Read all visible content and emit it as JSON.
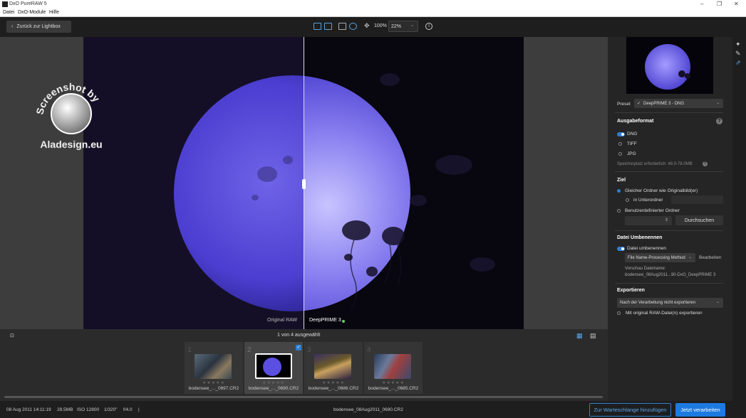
{
  "window": {
    "title": "DxO PureRAW 5",
    "controls": [
      "–",
      "❐",
      "✕"
    ]
  },
  "menu": [
    "Datei",
    "DxO-Module",
    "Hilfe"
  ],
  "toolbar": {
    "back_label": "Zurück zur Lightbox",
    "zoom_100": "100%",
    "zoom_value": "22%",
    "info_icon": "i"
  },
  "viewer": {
    "label_original": "Original RAW",
    "label_processed": "DeepPRIME 3",
    "watermark": "Screenshot by Aladesign.eu"
  },
  "panel": {
    "preset_label": "Preset",
    "preset_value": "DeepPRIME 3 - DNG",
    "output_heading": "Ausgabeformat",
    "format_dng": "DNG",
    "format_tiff": "TIFF",
    "format_jpg": "JPG",
    "storage_text": "Speicherplatz erforderlich: 48.0-78.0MB",
    "ziel_heading": "Ziel",
    "same_folder": "Gleicher Ordner wie Originalbild(er)",
    "subfolder": "in Unterordner",
    "custom_folder": "Benutzerdefinierter Ordner",
    "browse": "Durchsuchen",
    "rename_heading": "Datei Umbenennen",
    "rename_toggle": "Datei umbenennen",
    "rename_method": "File Name-Processing Method",
    "edit": "Bearbeiten",
    "preview_label": "Vorschau Dateiname:",
    "preview_value": "bodensee_08Aug2011...90-DxO_DeepPRIME 3",
    "export_heading": "Exportieren",
    "export_value": "Nach der Verarbeitung nicht exportieren",
    "export_raw": "Mit original RAW-Datei(n) exportieren"
  },
  "filmstrip": {
    "selection_text": "1 von 4 ausgewählt",
    "items": [
      {
        "num": "1",
        "name": "bodensee_..._0697.CR2"
      },
      {
        "num": "2",
        "name": "bodensee_..._0690.CR2"
      },
      {
        "num": "3",
        "name": "bodensee_..._0686.CR2"
      },
      {
        "num": "4",
        "name": "bodensee_..._0685.CR2"
      }
    ],
    "stars": "★★★★★"
  },
  "status": {
    "date": "08 Aug 2011 14:11:19",
    "size": "28.5MB",
    "iso": "ISO 12800",
    "shutter": "1/320\"",
    "aperture": "f/4.0",
    "sep": "|",
    "filename": "bodensee_08Aug2011_0690.CR2",
    "queue_button": "Zur Warteschlange hinzufügen",
    "process_button": "Jetzt verarbeiten"
  }
}
